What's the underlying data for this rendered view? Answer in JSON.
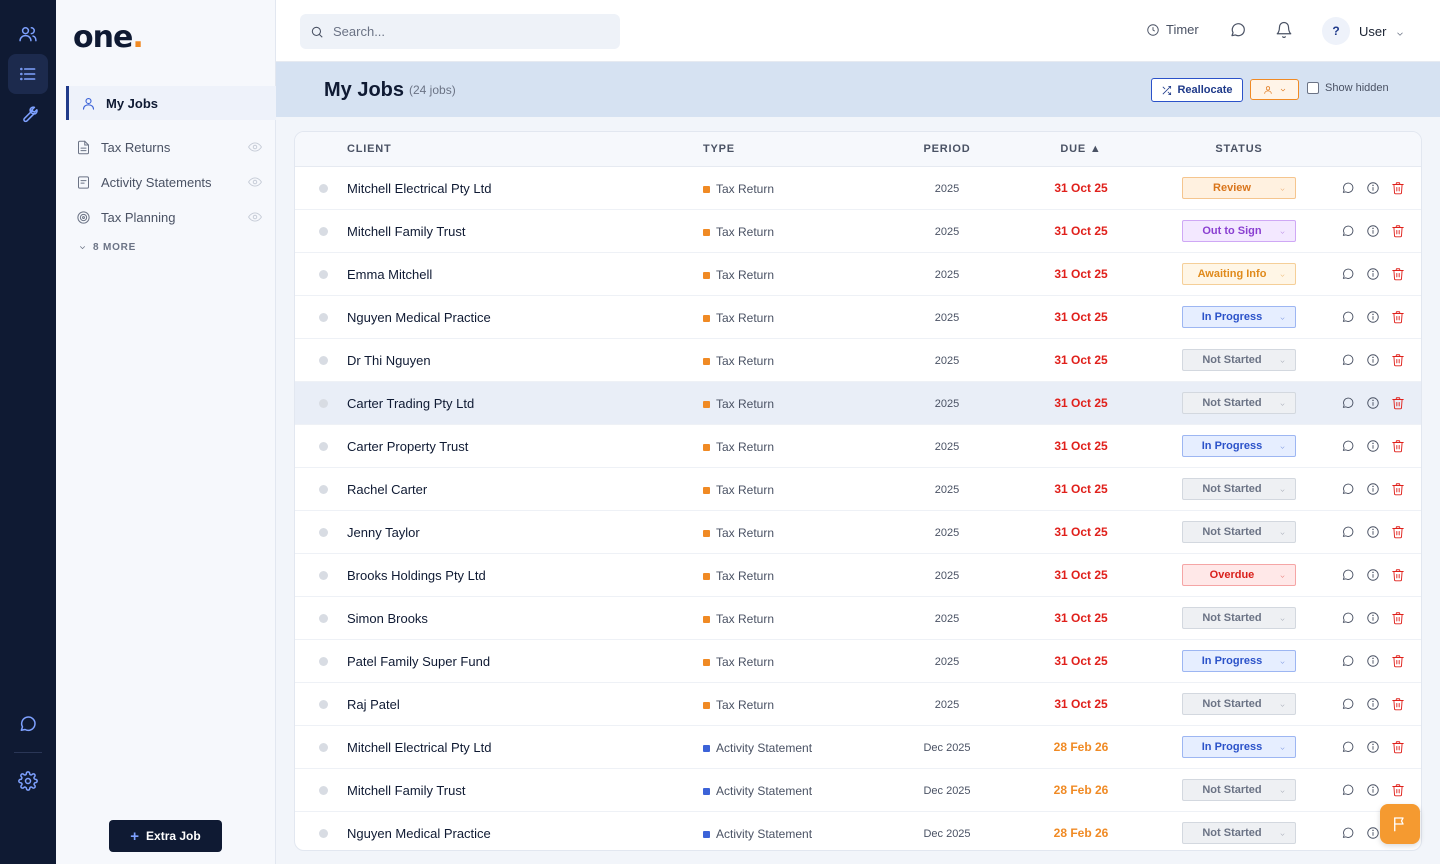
{
  "app": {
    "logo_text": "one",
    "logo_dot": "."
  },
  "rail": {
    "items": [
      {
        "icon": "users-icon"
      },
      {
        "icon": "list-icon",
        "active": true
      },
      {
        "icon": "wrench-icon"
      }
    ],
    "bottom": [
      {
        "icon": "chat-icon"
      },
      {
        "icon": "gear-icon"
      }
    ]
  },
  "nav": {
    "active_label": "My Jobs",
    "items": [
      {
        "label": "Tax Returns",
        "icon": "document-icon"
      },
      {
        "label": "Activity Statements",
        "icon": "statement-icon"
      },
      {
        "label": "Tax Planning",
        "icon": "target-icon"
      }
    ],
    "more_label": "8 MORE",
    "extra_job_label": "Extra Job"
  },
  "topbar": {
    "search_placeholder": "Search...",
    "timer_label": "Timer",
    "avatar_label": "?",
    "user_label": "User"
  },
  "page": {
    "title": "My Jobs",
    "count_label": "(24 jobs)",
    "reallocate_label": "Reallocate",
    "show_hidden_label": "Show hidden"
  },
  "table": {
    "headers": {
      "client": "CLIENT",
      "type": "TYPE",
      "period": "PERIOD",
      "due": "DUE ▲",
      "status": "STATUS"
    },
    "rows": [
      {
        "client": "Mitchell Electrical Pty Ltd",
        "type": "Tax Return",
        "period": "2025",
        "due": "31 Oct 25",
        "status": "Review"
      },
      {
        "client": "Mitchell Family Trust",
        "type": "Tax Return",
        "period": "2025",
        "due": "31 Oct 25",
        "status": "Out to Sign"
      },
      {
        "client": "Emma Mitchell",
        "type": "Tax Return",
        "period": "2025",
        "due": "31 Oct 25",
        "status": "Awaiting Info"
      },
      {
        "client": "Nguyen Medical Practice",
        "type": "Tax Return",
        "period": "2025",
        "due": "31 Oct 25",
        "status": "In Progress"
      },
      {
        "client": "Dr Thi Nguyen",
        "type": "Tax Return",
        "period": "2025",
        "due": "31 Oct 25",
        "status": "Not Started"
      },
      {
        "client": "Carter Trading Pty Ltd",
        "type": "Tax Return",
        "period": "2025",
        "due": "31 Oct 25",
        "status": "Not Started",
        "highlighted": true
      },
      {
        "client": "Carter Property Trust",
        "type": "Tax Return",
        "period": "2025",
        "due": "31 Oct 25",
        "status": "In Progress"
      },
      {
        "client": "Rachel Carter",
        "type": "Tax Return",
        "period": "2025",
        "due": "31 Oct 25",
        "status": "Not Started"
      },
      {
        "client": "Jenny Taylor",
        "type": "Tax Return",
        "period": "2025",
        "due": "31 Oct 25",
        "status": "Not Started"
      },
      {
        "client": "Brooks Holdings Pty Ltd",
        "type": "Tax Return",
        "period": "2025",
        "due": "31 Oct 25",
        "status": "Overdue"
      },
      {
        "client": "Simon Brooks",
        "type": "Tax Return",
        "period": "2025",
        "due": "31 Oct 25",
        "status": "Not Started"
      },
      {
        "client": "Patel Family Super Fund",
        "type": "Tax Return",
        "period": "2025",
        "due": "31 Oct 25",
        "status": "In Progress"
      },
      {
        "client": "Raj Patel",
        "type": "Tax Return",
        "period": "2025",
        "due": "31 Oct 25",
        "status": "Not Started"
      },
      {
        "client": "Mitchell Electrical Pty Ltd",
        "type": "Activity Statement",
        "period": "Dec 2025",
        "due": "28 Feb 26",
        "status": "In Progress"
      },
      {
        "client": "Mitchell Family Trust",
        "type": "Activity Statement",
        "period": "Dec 2025",
        "due": "28 Feb 26",
        "status": "Not Started"
      },
      {
        "client": "Nguyen Medical Practice",
        "type": "Activity Statement",
        "period": "Dec 2025",
        "due": "28 Feb 26",
        "status": "Not Started"
      }
    ]
  },
  "colors": {
    "tax_return": "#f08a24",
    "activity_statement": "#3c63d8",
    "due_overdue": "#e0201b",
    "due_upcoming": "#f08a24",
    "status": {
      "Review": {
        "bg": "#fff1e0",
        "border": "#f5c58e",
        "text": "#d9751b"
      },
      "Out to Sign": {
        "bg": "#f3e8ff",
        "border": "#cfa8f5",
        "text": "#8a3fd1"
      },
      "Awaiting Info": {
        "bg": "#fff6e6",
        "border": "#f5cf98",
        "text": "#e08a1b"
      },
      "In Progress": {
        "bg": "#e6eeff",
        "border": "#9db6f2",
        "text": "#2b52c9"
      },
      "Not Started": {
        "bg": "#eef0f3",
        "border": "#d3d8df",
        "text": "#6b7385"
      },
      "Overdue": {
        "bg": "#ffe8e8",
        "border": "#f5a5a5",
        "text": "#d9201b"
      }
    }
  },
  "row_actions": [
    "comment-icon",
    "info-icon",
    "trash-icon"
  ],
  "fab_icon": "flag-icon"
}
